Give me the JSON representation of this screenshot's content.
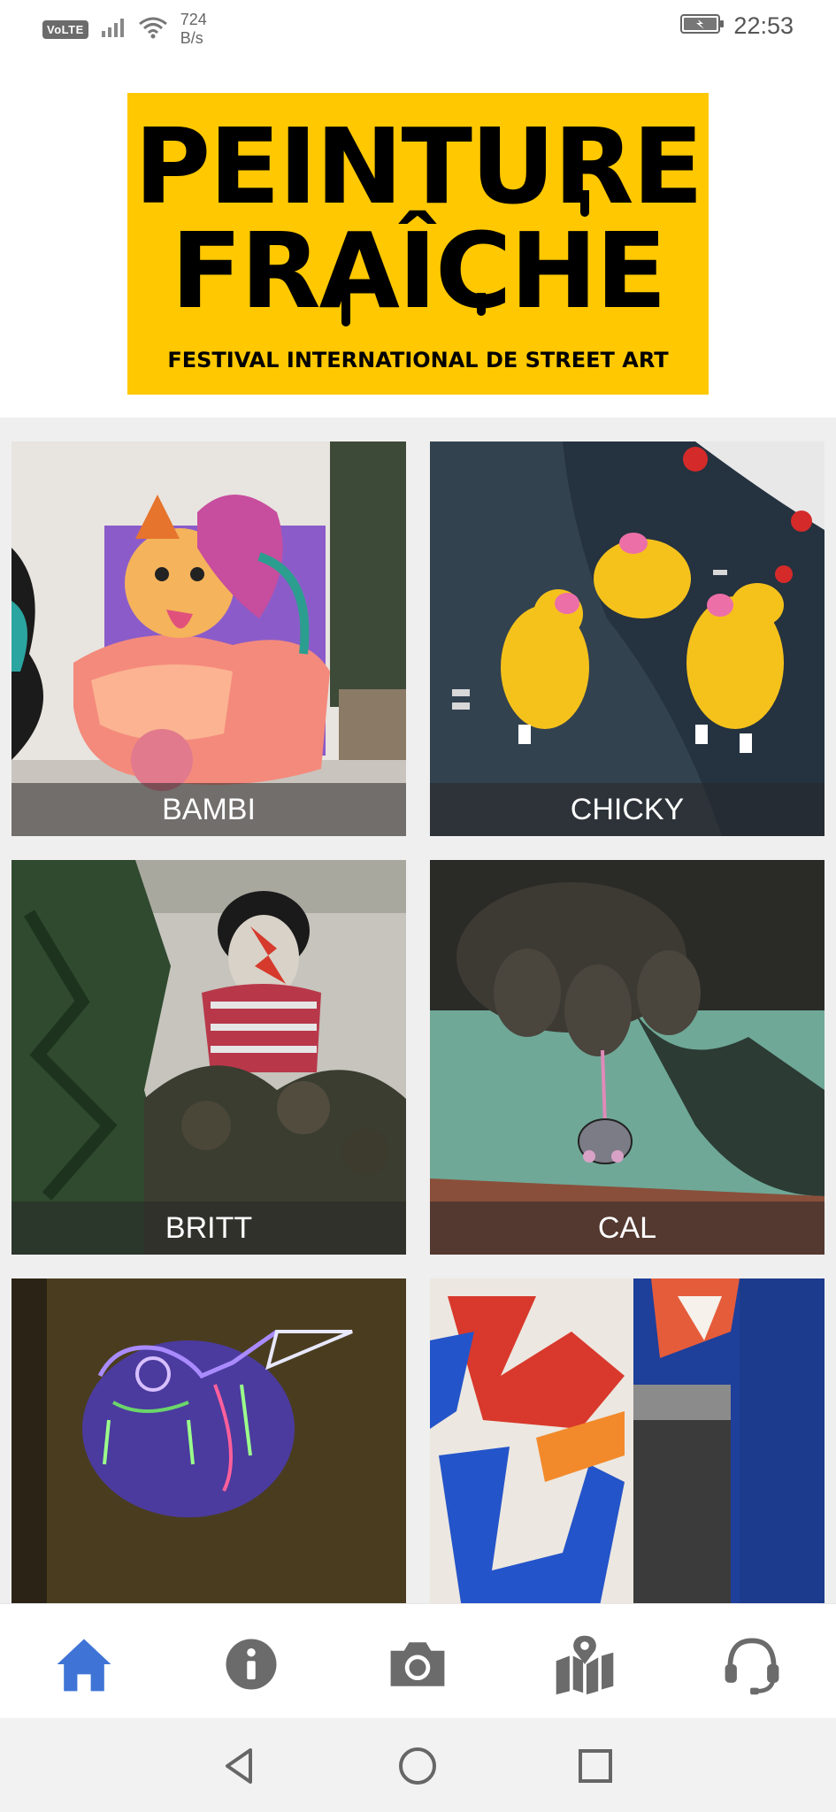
{
  "status_bar": {
    "volte": "VoLTE",
    "speed_value": "724",
    "speed_unit": "B/s",
    "time": "22:53",
    "icons": [
      "signal-icon",
      "wifi-icon",
      "battery-charging-icon"
    ]
  },
  "logo": {
    "line1": "PEINTURE",
    "line2": "FRAÎCHE",
    "subtitle": "FESTIVAL INTERNATIONAL DE STREET ART"
  },
  "artists": [
    {
      "name": "BAMBI"
    },
    {
      "name": "CHICKY"
    },
    {
      "name": "BRITT"
    },
    {
      "name": "CAL"
    },
    {
      "name": ""
    },
    {
      "name": ""
    }
  ],
  "tabbar": {
    "items": [
      {
        "icon": "home-icon",
        "active": true
      },
      {
        "icon": "info-icon",
        "active": false
      },
      {
        "icon": "camera-icon",
        "active": false
      },
      {
        "icon": "map-icon",
        "active": false
      },
      {
        "icon": "headset-icon",
        "active": false
      }
    ],
    "active_color": "#3f74d6",
    "inactive_color": "#6b6b6b"
  },
  "system_nav": [
    "back-icon",
    "home-circle-icon",
    "recents-icon"
  ],
  "colors": {
    "logo_background": "#ffc800",
    "grid_background": "#efefef"
  }
}
